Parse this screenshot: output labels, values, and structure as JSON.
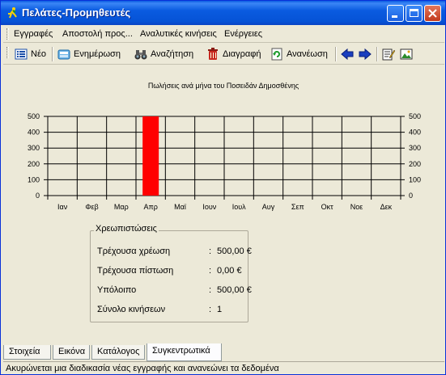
{
  "window": {
    "title": "Πελάτες-Προμηθευτές"
  },
  "menu": {
    "items": [
      "Εγγραφές",
      "Αποστολή προς...",
      "Αναλυτικές κινήσεις",
      "Ενέργειες"
    ]
  },
  "toolbar": {
    "new_label": "Νέο",
    "update_label": "Ενημέρωση",
    "search_label": "Αναζήτηση",
    "delete_label": "Διαγραφή",
    "refresh_label": "Ανανέωση"
  },
  "chart_data": {
    "type": "bar",
    "title": "Πωλήσεις ανά μήνα του Ποσειδάν Δημοσθένης",
    "categories": [
      "Ιαν",
      "Φεβ",
      "Μαρ",
      "Απρ",
      "Μαϊ",
      "Ιουν",
      "Ιουλ",
      "Αυγ",
      "Σεπ",
      "Οκτ",
      "Νοε",
      "Δεκ"
    ],
    "values": [
      0,
      0,
      0,
      500,
      0,
      0,
      0,
      0,
      0,
      0,
      0,
      0
    ],
    "yticks": [
      "0",
      "100",
      "200",
      "300",
      "400",
      "500"
    ],
    "ylim": [
      0,
      500
    ],
    "bar_color": "#ff0000",
    "grid": true
  },
  "balances": {
    "title": "Χρεωπιστώσεις",
    "rows": [
      {
        "label": "Τρέχουσα χρέωση",
        "value": "500,00 €"
      },
      {
        "label": "Τρέχουσα πίστωση",
        "value": "0,00 €"
      },
      {
        "label": "Υπόλοιπο",
        "value": "500,00 €"
      },
      {
        "label": "Σύνολο κινήσεων",
        "value": "1"
      }
    ]
  },
  "tabs": [
    "Στοιχεία",
    "Εικόνα",
    "Κατάλογος",
    "Συγκεντρωτικά"
  ],
  "active_tab": "Συγκεντρωτικά",
  "status": {
    "text": "Ακυρώνεται μια διαδικασία νέας εγγραφής και ανανεώνει τα δεδομένα"
  }
}
